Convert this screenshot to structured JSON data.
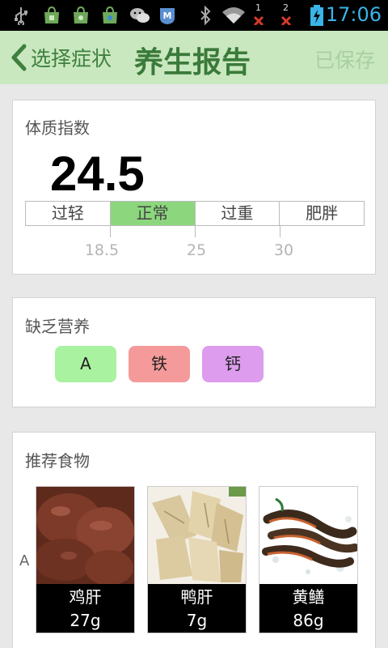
{
  "status_bar": {
    "time": "17:06",
    "icons": [
      "usb-icon",
      "store-icon",
      "store-icon",
      "store-icon",
      "wechat-icon",
      "app-icon",
      "bluetooth-icon",
      "wifi-icon",
      "signal-1-icon",
      "signal-2-icon",
      "battery-charging-icon"
    ],
    "sim1_label": "1",
    "sim2_label": "2"
  },
  "header": {
    "back_label": "选择症状",
    "title": "养生报告",
    "saved_label": "已保存"
  },
  "bmi": {
    "title": "体质指数",
    "value": "24.5",
    "categories": [
      "过轻",
      "正常",
      "过重",
      "肥胖"
    ],
    "active_category": "正常",
    "thresholds": [
      "18.5",
      "25",
      "30"
    ]
  },
  "nutrients": {
    "title": "缺乏营养",
    "items": [
      {
        "label": "A",
        "color": "#a9f2a0"
      },
      {
        "label": "铁",
        "color": "#f59a9a"
      },
      {
        "label": "钙",
        "color": "#dd9ced"
      }
    ]
  },
  "foods": {
    "title": "推荐食物",
    "row_label": "A",
    "items": [
      {
        "name": "鸡肝",
        "amount": "27g"
      },
      {
        "name": "鸭肝",
        "amount": "7g"
      },
      {
        "name": "黄鳝",
        "amount": "86g"
      }
    ]
  },
  "colors": {
    "header_bg": "#c9e8bf",
    "accent_green": "#3a7a3a",
    "active_segment": "#8cd77d",
    "time_color": "#39b4e6"
  }
}
